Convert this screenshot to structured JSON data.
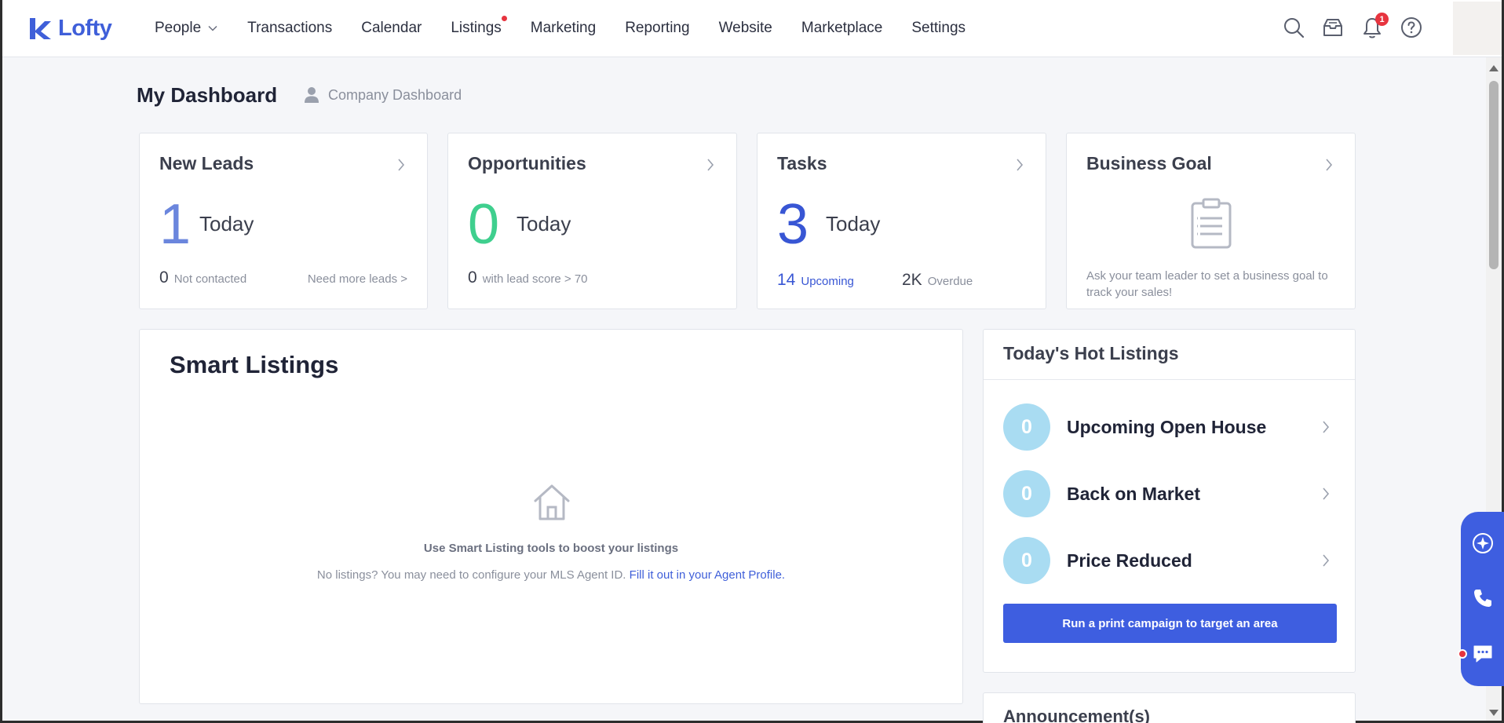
{
  "app": {
    "logo_text": "Lofty"
  },
  "nav": {
    "items": [
      {
        "label": "People",
        "has_dropdown": true
      },
      {
        "label": "Transactions"
      },
      {
        "label": "Calendar"
      },
      {
        "label": "Listings",
        "has_dot": true
      },
      {
        "label": "Marketing"
      },
      {
        "label": "Reporting"
      },
      {
        "label": "Website"
      },
      {
        "label": "Marketplace"
      },
      {
        "label": "Settings"
      }
    ],
    "notification_count": "1",
    "icons": [
      "search-icon",
      "inbox-icon",
      "bell-icon",
      "help-icon"
    ]
  },
  "header": {
    "title": "My Dashboard",
    "company_link": "Company Dashboard"
  },
  "cards": {
    "new_leads": {
      "title": "New Leads",
      "count": "1",
      "period": "Today",
      "not_contacted_count": "0",
      "not_contacted_label": "Not contacted",
      "more_link": "Need more leads >"
    },
    "opportunities": {
      "title": "Opportunities",
      "count": "0",
      "period": "Today",
      "score_count": "0",
      "score_label": "with lead score > 70"
    },
    "tasks": {
      "title": "Tasks",
      "count": "3",
      "period": "Today",
      "upcoming_count": "14",
      "upcoming_label": "Upcoming",
      "overdue_count": "2K",
      "overdue_label": "Overdue"
    },
    "business_goal": {
      "title": "Business Goal",
      "message": "Ask your team leader to set a business goal to track your sales!"
    }
  },
  "smart_listings": {
    "title": "Smart Listings",
    "empty_title": "Use Smart Listing tools to boost your listings",
    "empty_sub": "No listings? You may need to configure your MLS Agent ID.",
    "empty_link": "Fill it out in your Agent Profile."
  },
  "hot_listings": {
    "title": "Today's Hot Listings",
    "rows": [
      {
        "count": "0",
        "label": "Upcoming Open House"
      },
      {
        "count": "0",
        "label": "Back on Market"
      },
      {
        "count": "0",
        "label": "Price Reduced"
      }
    ],
    "cta": "Run a print campaign to target an area"
  },
  "announcements": {
    "title": "Announcement(s)"
  },
  "colors": {
    "brand": "#3f5fd9",
    "leads_number": "#6b86dd",
    "opportunities_number": "#3fcf8e",
    "tasks_number": "#3856d4",
    "hot_circle": "#a9dcf2",
    "badge": "#e7343f"
  },
  "float_widget": {
    "icons": [
      "assistant-icon",
      "phone-icon",
      "chat-icon"
    ]
  }
}
